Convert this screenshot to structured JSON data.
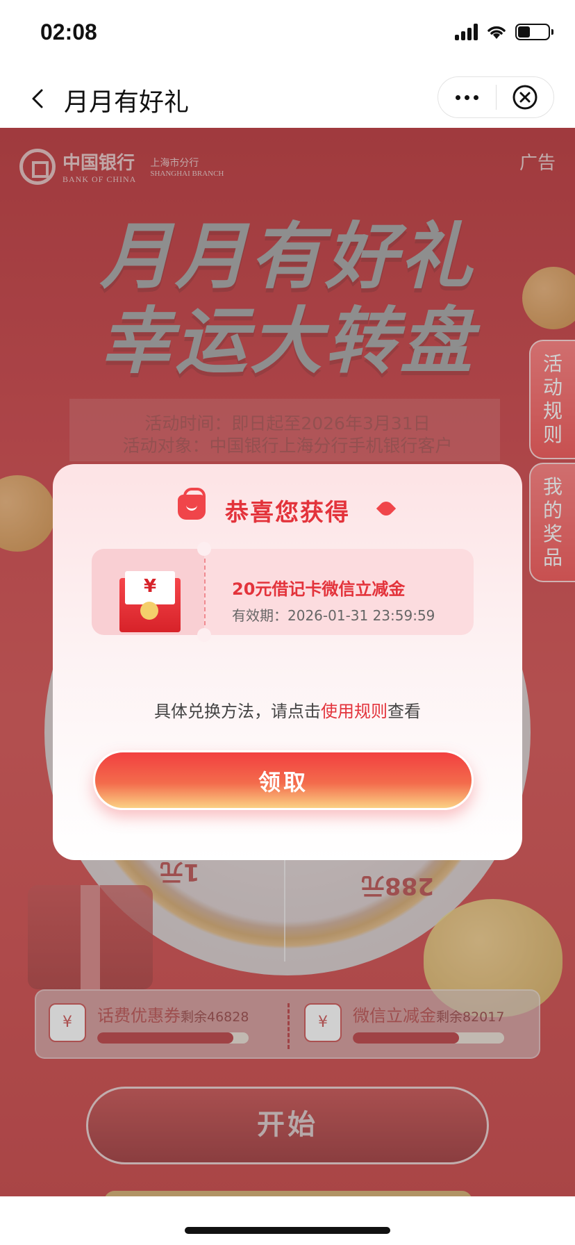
{
  "status_bar": {
    "time": "02:08"
  },
  "nav": {
    "title": "月月有好礼"
  },
  "header": {
    "bank_name_cn": "中国银行",
    "bank_name_en": "BANK OF CHINA",
    "branch_cn": "上海市分行",
    "branch_en": "SHANGHAI BRANCH",
    "ad_label": "广告"
  },
  "banner": {
    "title_line1": "月月有好礼",
    "title_line2": "幸运大转盘",
    "activity_time": "活动时间：即日起至2026年3月31日",
    "activity_target": "活动对象：中国银行上海分行手机银行客户"
  },
  "wheel": {
    "prize_a": "1元",
    "prize_b": "288元"
  },
  "side_tabs": {
    "rules": "活动规则",
    "my_prizes": "我的奖品"
  },
  "stock": [
    {
      "name": "话费优惠券",
      "remaining": "剩余46828",
      "progress": 0.9
    },
    {
      "name": "微信立减金",
      "remaining": "剩余82017",
      "progress": 0.7
    }
  ],
  "start_button": "开始",
  "modal": {
    "title": "恭喜您获得",
    "coupon_symbol": "¥",
    "coupon_name": "20元借记卡微信立减金",
    "coupon_expiry": "有效期：2026-01-31 23:59:59",
    "hint_prefix": "具体兑换方法，请点击",
    "hint_link": "使用规则",
    "hint_suffix": "查看",
    "claim_button": "领取"
  },
  "colors": {
    "primary_red": "#e3333b",
    "banner_red": "#c92a2f",
    "gold": "#d0a35b"
  }
}
